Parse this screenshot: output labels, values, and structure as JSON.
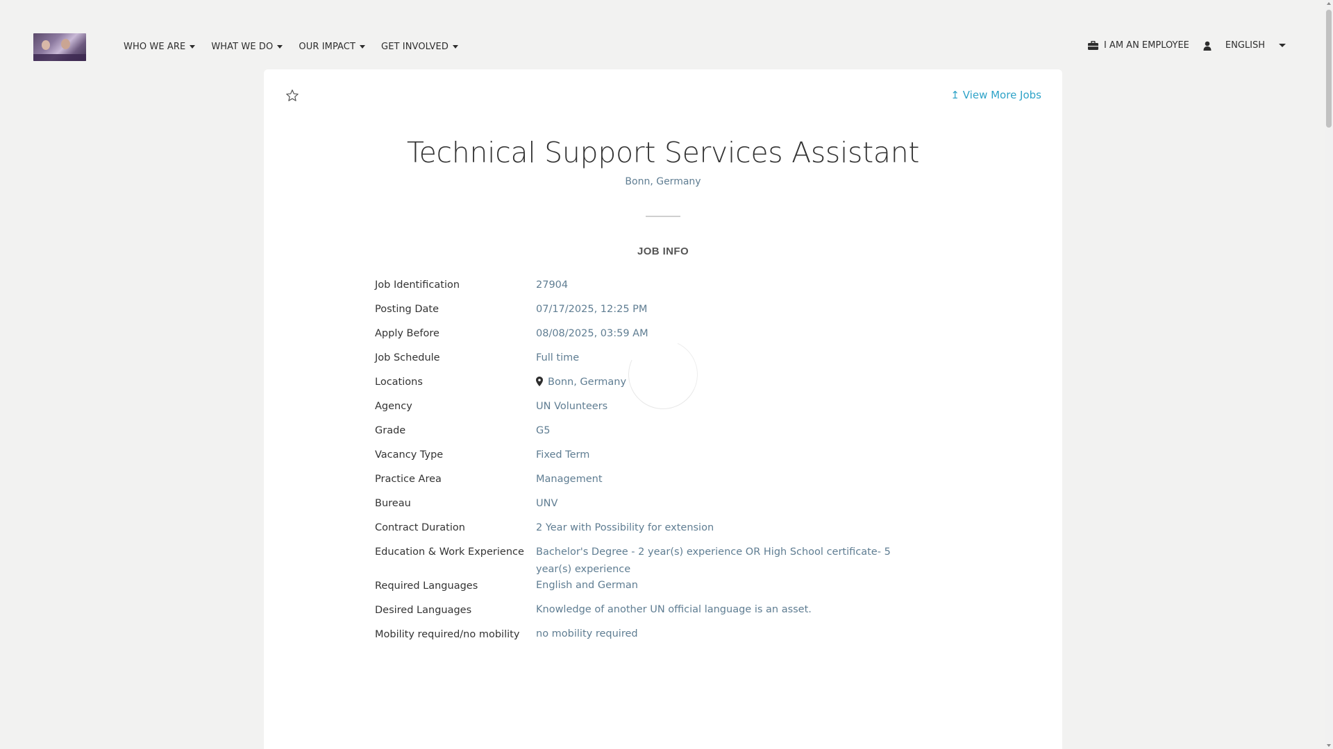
{
  "header": {
    "logo_alt": "UNDP logo",
    "nav": [
      {
        "label": "WHO WE ARE"
      },
      {
        "label": "WHAT WE DO"
      },
      {
        "label": "OUR IMPACT"
      },
      {
        "label": "GET INVOLVED"
      }
    ],
    "employee_label": "I AM AN EMPLOYEE",
    "language_label": "ENGLISH"
  },
  "job": {
    "view_more": "↥ View More Jobs",
    "title": "Technical Support Services Assistant",
    "location": "Bonn, Germany",
    "section_title": "JOB INFO",
    "rows": [
      {
        "label": "Job Identification",
        "value": "27904"
      },
      {
        "label": "Posting Date",
        "value": "07/17/2025, 12:25 PM"
      },
      {
        "label": "Apply Before",
        "value": "08/08/2025, 03:59 AM"
      },
      {
        "label": "Job Schedule",
        "value": "Full time"
      },
      {
        "label": "Locations",
        "value": "Bonn, Germany"
      },
      {
        "label": "Agency",
        "value": "UN Volunteers"
      },
      {
        "label": "Grade",
        "value": "G5"
      },
      {
        "label": "Vacancy Type",
        "value": "Fixed Term"
      },
      {
        "label": "Practice Area",
        "value": "Management"
      },
      {
        "label": "Bureau",
        "value": "UNV"
      },
      {
        "label": "Contract Duration",
        "value": "2 Year with Possibility for extension"
      },
      {
        "label": "Education & Work Experience",
        "value": "Bachelor's Degree - 2 year(s) experience OR High School certificate- 5 year(s) experience"
      },
      {
        "label": "Required Languages",
        "value": "English and German"
      },
      {
        "label": "Desired Languages",
        "value": "Knowledge of another UN official language is an asset."
      },
      {
        "label": "Mobility required/no mobility",
        "value": "no mobility required"
      }
    ]
  },
  "colors": {
    "accent_link": "#2ea3c8",
    "value_text": "#5f7d92",
    "page_bg": "#f2f2f1"
  }
}
